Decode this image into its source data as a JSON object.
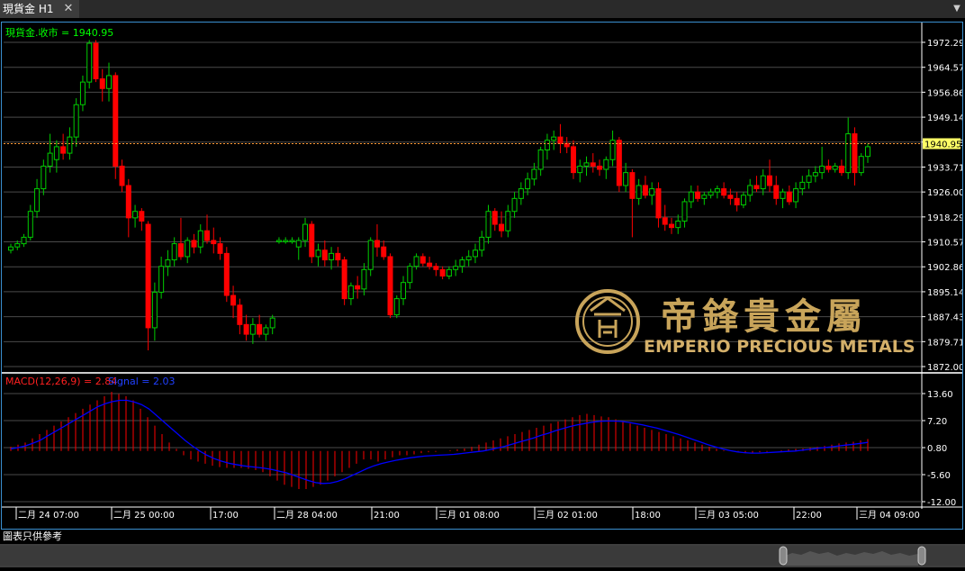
{
  "tab": {
    "title": "現貨金 H1",
    "close_glyph": "✕",
    "menu_glyph": "▼"
  },
  "chart_data": {
    "type": "candlestick",
    "symbol_label": "現貨金.收市 = 1940.95",
    "last_price": 1940.95,
    "last_price_label": "1940.95",
    "ylim": [
      1872.0,
      1972.29
    ],
    "y_ticks": [
      "1972.29",
      "1964.57",
      "1956.86",
      "1949.14",
      "1941.43",
      "1933.71",
      "1926.00",
      "1918.29",
      "1910.57",
      "1902.86",
      "1895.14",
      "1887.43",
      "1879.71",
      "1872.00"
    ],
    "x_ticks": [
      "二月 24 07:00",
      "二月 25 00:00",
      "17:00",
      "二月 28 04:00",
      "21:00",
      "三月 01 08:00",
      "三月 02 01:00",
      "18:00",
      "三月 03 05:00",
      "22:00",
      "三月 04 09:00"
    ],
    "candles": [
      {
        "o": 1908,
        "h": 1910,
        "l": 1907,
        "c": 1909
      },
      {
        "o": 1909,
        "h": 1911,
        "l": 1908,
        "c": 1910
      },
      {
        "o": 1910,
        "h": 1913,
        "l": 1909,
        "c": 1912
      },
      {
        "o": 1912,
        "h": 1922,
        "l": 1911,
        "c": 1920
      },
      {
        "o": 1920,
        "h": 1930,
        "l": 1918,
        "c": 1927
      },
      {
        "o": 1927,
        "h": 1936,
        "l": 1925,
        "c": 1934
      },
      {
        "o": 1934,
        "h": 1944,
        "l": 1932,
        "c": 1938
      },
      {
        "o": 1936,
        "h": 1942,
        "l": 1932,
        "c": 1940
      },
      {
        "o": 1940,
        "h": 1944,
        "l": 1936,
        "c": 1938
      },
      {
        "o": 1938,
        "h": 1946,
        "l": 1936,
        "c": 1943
      },
      {
        "o": 1943,
        "h": 1955,
        "l": 1940,
        "c": 1953
      },
      {
        "o": 1953,
        "h": 1962,
        "l": 1951,
        "c": 1960
      },
      {
        "o": 1960,
        "h": 1973,
        "l": 1958,
        "c": 1972
      },
      {
        "o": 1972,
        "h": 1973,
        "l": 1960,
        "c": 1961
      },
      {
        "o": 1961,
        "h": 1964,
        "l": 1954,
        "c": 1958
      },
      {
        "o": 1958,
        "h": 1966,
        "l": 1954,
        "c": 1962
      },
      {
        "o": 1962,
        "h": 1963,
        "l": 1930,
        "c": 1934
      },
      {
        "o": 1934,
        "h": 1936,
        "l": 1926,
        "c": 1928
      },
      {
        "o": 1928,
        "h": 1930,
        "l": 1912,
        "c": 1918
      },
      {
        "o": 1918,
        "h": 1922,
        "l": 1915,
        "c": 1920
      },
      {
        "o": 1920,
        "h": 1921,
        "l": 1914,
        "c": 1917
      },
      {
        "o": 1916,
        "h": 1917,
        "l": 1877,
        "c": 1884
      },
      {
        "o": 1884,
        "h": 1898,
        "l": 1880,
        "c": 1895
      },
      {
        "o": 1895,
        "h": 1906,
        "l": 1893,
        "c": 1903
      },
      {
        "o": 1903,
        "h": 1908,
        "l": 1900,
        "c": 1905
      },
      {
        "o": 1905,
        "h": 1912,
        "l": 1903,
        "c": 1910
      },
      {
        "o": 1910,
        "h": 1918,
        "l": 1905,
        "c": 1906
      },
      {
        "o": 1906,
        "h": 1912,
        "l": 1904,
        "c": 1911
      },
      {
        "o": 1911,
        "h": 1913,
        "l": 1907,
        "c": 1909
      },
      {
        "o": 1909,
        "h": 1916,
        "l": 1907,
        "c": 1914
      },
      {
        "o": 1914,
        "h": 1919,
        "l": 1910,
        "c": 1911
      },
      {
        "o": 1911,
        "h": 1915,
        "l": 1907,
        "c": 1910
      },
      {
        "o": 1910,
        "h": 1912,
        "l": 1905,
        "c": 1907
      },
      {
        "o": 1907,
        "h": 1909,
        "l": 1892,
        "c": 1894
      },
      {
        "o": 1894,
        "h": 1897,
        "l": 1887,
        "c": 1891
      },
      {
        "o": 1891,
        "h": 1893,
        "l": 1882,
        "c": 1885
      },
      {
        "o": 1885,
        "h": 1888,
        "l": 1880,
        "c": 1882
      },
      {
        "o": 1882,
        "h": 1887,
        "l": 1879,
        "c": 1885
      },
      {
        "o": 1885,
        "h": 1888,
        "l": 1881,
        "c": 1882
      },
      {
        "o": 1882,
        "h": 1885,
        "l": 1880,
        "c": 1884
      },
      {
        "o": 1884,
        "h": 1888,
        "l": 1882,
        "c": 1887
      },
      {
        "o": 1911,
        "h": 1912,
        "l": 1910,
        "c": 1911
      },
      {
        "o": 1911,
        "h": 1912,
        "l": 1910,
        "c": 1911
      },
      {
        "o": 1911,
        "h": 1912,
        "l": 1910,
        "c": 1911
      },
      {
        "o": 1909,
        "h": 1912,
        "l": 1905,
        "c": 1911
      },
      {
        "o": 1911,
        "h": 1918,
        "l": 1909,
        "c": 1916
      },
      {
        "o": 1916,
        "h": 1917,
        "l": 1904,
        "c": 1906
      },
      {
        "o": 1906,
        "h": 1910,
        "l": 1903,
        "c": 1908
      },
      {
        "o": 1908,
        "h": 1911,
        "l": 1903,
        "c": 1905
      },
      {
        "o": 1905,
        "h": 1909,
        "l": 1902,
        "c": 1907
      },
      {
        "o": 1907,
        "h": 1909,
        "l": 1903,
        "c": 1905
      },
      {
        "o": 1905,
        "h": 1906,
        "l": 1891,
        "c": 1893
      },
      {
        "o": 1893,
        "h": 1898,
        "l": 1891,
        "c": 1897
      },
      {
        "o": 1897,
        "h": 1900,
        "l": 1893,
        "c": 1896
      },
      {
        "o": 1896,
        "h": 1904,
        "l": 1894,
        "c": 1902
      },
      {
        "o": 1902,
        "h": 1912,
        "l": 1900,
        "c": 1911
      },
      {
        "o": 1911,
        "h": 1916,
        "l": 1906,
        "c": 1909
      },
      {
        "o": 1909,
        "h": 1911,
        "l": 1905,
        "c": 1906
      },
      {
        "o": 1906,
        "h": 1907,
        "l": 1887,
        "c": 1888
      },
      {
        "o": 1888,
        "h": 1894,
        "l": 1887,
        "c": 1893
      },
      {
        "o": 1893,
        "h": 1900,
        "l": 1891,
        "c": 1898
      },
      {
        "o": 1898,
        "h": 1904,
        "l": 1896,
        "c": 1903
      },
      {
        "o": 1903,
        "h": 1907,
        "l": 1902,
        "c": 1906
      },
      {
        "o": 1906,
        "h": 1907,
        "l": 1903,
        "c": 1904
      },
      {
        "o": 1904,
        "h": 1906,
        "l": 1902,
        "c": 1903
      },
      {
        "o": 1903,
        "h": 1904,
        "l": 1900,
        "c": 1902
      },
      {
        "o": 1902,
        "h": 1903,
        "l": 1899,
        "c": 1900
      },
      {
        "o": 1900,
        "h": 1903,
        "l": 1899,
        "c": 1902
      },
      {
        "o": 1902,
        "h": 1905,
        "l": 1900,
        "c": 1903
      },
      {
        "o": 1903,
        "h": 1906,
        "l": 1901,
        "c": 1905
      },
      {
        "o": 1905,
        "h": 1908,
        "l": 1903,
        "c": 1906
      },
      {
        "o": 1906,
        "h": 1910,
        "l": 1904,
        "c": 1908
      },
      {
        "o": 1908,
        "h": 1914,
        "l": 1906,
        "c": 1912
      },
      {
        "o": 1912,
        "h": 1922,
        "l": 1910,
        "c": 1920
      },
      {
        "o": 1920,
        "h": 1921,
        "l": 1914,
        "c": 1916
      },
      {
        "o": 1916,
        "h": 1920,
        "l": 1912,
        "c": 1914
      },
      {
        "o": 1914,
        "h": 1922,
        "l": 1912,
        "c": 1920
      },
      {
        "o": 1920,
        "h": 1926,
        "l": 1918,
        "c": 1924
      },
      {
        "o": 1924,
        "h": 1929,
        "l": 1922,
        "c": 1927
      },
      {
        "o": 1927,
        "h": 1932,
        "l": 1925,
        "c": 1930
      },
      {
        "o": 1930,
        "h": 1935,
        "l": 1928,
        "c": 1933
      },
      {
        "o": 1933,
        "h": 1940,
        "l": 1931,
        "c": 1939
      },
      {
        "o": 1939,
        "h": 1944,
        "l": 1936,
        "c": 1942
      },
      {
        "o": 1942,
        "h": 1945,
        "l": 1939,
        "c": 1943
      },
      {
        "o": 1943,
        "h": 1947,
        "l": 1938,
        "c": 1941
      },
      {
        "o": 1941,
        "h": 1943,
        "l": 1938,
        "c": 1940
      },
      {
        "o": 1940,
        "h": 1942,
        "l": 1930,
        "c": 1932
      },
      {
        "o": 1932,
        "h": 1936,
        "l": 1929,
        "c": 1934
      },
      {
        "o": 1934,
        "h": 1937,
        "l": 1931,
        "c": 1935
      },
      {
        "o": 1935,
        "h": 1938,
        "l": 1932,
        "c": 1934
      },
      {
        "o": 1934,
        "h": 1936,
        "l": 1931,
        "c": 1933
      },
      {
        "o": 1933,
        "h": 1937,
        "l": 1930,
        "c": 1936
      },
      {
        "o": 1936,
        "h": 1945,
        "l": 1934,
        "c": 1942
      },
      {
        "o": 1942,
        "h": 1943,
        "l": 1926,
        "c": 1928
      },
      {
        "o": 1928,
        "h": 1935,
        "l": 1926,
        "c": 1932
      },
      {
        "o": 1932,
        "h": 1933,
        "l": 1912,
        "c": 1924
      },
      {
        "o": 1924,
        "h": 1930,
        "l": 1922,
        "c": 1928
      },
      {
        "o": 1928,
        "h": 1931,
        "l": 1924,
        "c": 1925
      },
      {
        "o": 1925,
        "h": 1929,
        "l": 1922,
        "c": 1927
      },
      {
        "o": 1927,
        "h": 1929,
        "l": 1915,
        "c": 1918
      },
      {
        "o": 1918,
        "h": 1922,
        "l": 1914,
        "c": 1916
      },
      {
        "o": 1916,
        "h": 1918,
        "l": 1913,
        "c": 1915
      },
      {
        "o": 1915,
        "h": 1919,
        "l": 1913,
        "c": 1917
      },
      {
        "o": 1917,
        "h": 1924,
        "l": 1915,
        "c": 1923
      },
      {
        "o": 1923,
        "h": 1928,
        "l": 1921,
        "c": 1926
      },
      {
        "o": 1926,
        "h": 1928,
        "l": 1923,
        "c": 1924
      },
      {
        "o": 1924,
        "h": 1926,
        "l": 1922,
        "c": 1925
      },
      {
        "o": 1925,
        "h": 1927,
        "l": 1924,
        "c": 1926
      },
      {
        "o": 1926,
        "h": 1928,
        "l": 1924,
        "c": 1927
      },
      {
        "o": 1927,
        "h": 1929,
        "l": 1924,
        "c": 1925
      },
      {
        "o": 1925,
        "h": 1927,
        "l": 1922,
        "c": 1924
      },
      {
        "o": 1924,
        "h": 1926,
        "l": 1920,
        "c": 1922
      },
      {
        "o": 1922,
        "h": 1926,
        "l": 1921,
        "c": 1925
      },
      {
        "o": 1925,
        "h": 1930,
        "l": 1923,
        "c": 1928
      },
      {
        "o": 1928,
        "h": 1931,
        "l": 1926,
        "c": 1927
      },
      {
        "o": 1927,
        "h": 1933,
        "l": 1925,
        "c": 1931
      },
      {
        "o": 1931,
        "h": 1936,
        "l": 1926,
        "c": 1928
      },
      {
        "o": 1928,
        "h": 1931,
        "l": 1922,
        "c": 1924
      },
      {
        "o": 1924,
        "h": 1927,
        "l": 1921,
        "c": 1926
      },
      {
        "o": 1926,
        "h": 1928,
        "l": 1922,
        "c": 1923
      },
      {
        "o": 1923,
        "h": 1929,
        "l": 1921,
        "c": 1927
      },
      {
        "o": 1927,
        "h": 1931,
        "l": 1925,
        "c": 1929
      },
      {
        "o": 1929,
        "h": 1933,
        "l": 1927,
        "c": 1931
      },
      {
        "o": 1931,
        "h": 1934,
        "l": 1929,
        "c": 1932
      },
      {
        "o": 1932,
        "h": 1940,
        "l": 1930,
        "c": 1934
      },
      {
        "o": 1934,
        "h": 1936,
        "l": 1932,
        "c": 1933
      },
      {
        "o": 1933,
        "h": 1935,
        "l": 1932,
        "c": 1934
      },
      {
        "o": 1934,
        "h": 1936,
        "l": 1931,
        "c": 1932
      },
      {
        "o": 1932,
        "h": 1949,
        "l": 1930,
        "c": 1944
      },
      {
        "o": 1944,
        "h": 1946,
        "l": 1928,
        "c": 1932
      },
      {
        "o": 1932,
        "h": 1938,
        "l": 1931,
        "c": 1937
      },
      {
        "o": 1937,
        "h": 1941,
        "l": 1935,
        "c": 1940
      }
    ],
    "macd": {
      "label": "MACD(12,26,9) = 2.84",
      "signal_label": "Signal = 2.03",
      "value": 2.84,
      "signal": 2.03,
      "y_ticks": [
        "13.60",
        "7.20",
        "0.80",
        "-5.60",
        "-12.00"
      ],
      "ylim": [
        -12.0,
        13.6
      ],
      "histogram": [
        1,
        1.5,
        2,
        3,
        4,
        5,
        6,
        7,
        8,
        9,
        10,
        11,
        12,
        13,
        14,
        13.5,
        13,
        12,
        10,
        8,
        6,
        4,
        2,
        0.5,
        -1,
        -2,
        -2.5,
        -3,
        -3.5,
        -3.8,
        -4,
        -4,
        -4,
        -4.2,
        -4.5,
        -5,
        -6,
        -7,
        -8,
        -8.5,
        -9,
        -9,
        -8.5,
        -8,
        -7,
        -6,
        -5,
        -4,
        -3,
        -2,
        -2,
        -2.5,
        -2,
        -1.5,
        -1,
        -1,
        -0.8,
        -0.5,
        -0.3,
        -0.2,
        0,
        0.2,
        0.4,
        0.6,
        1,
        1.5,
        2,
        2.5,
        3,
        3.5,
        4,
        4.5,
        5,
        5.5,
        6,
        6.5,
        7,
        7.5,
        8,
        8.5,
        8.8,
        8.5,
        8.2,
        8,
        7.5,
        7,
        6.5,
        6,
        5.5,
        5,
        4.5,
        4,
        3.5,
        3,
        2.5,
        2,
        1.5,
        1,
        0.5,
        0.2,
        0,
        -0.3,
        -0.5,
        -0.5,
        -0.3,
        -0.2,
        0,
        0.2,
        0.4,
        0.5,
        0.6,
        0.8,
        1,
        1.2,
        1.5,
        1.8,
        2,
        2.2,
        2.5,
        2.84
      ],
      "signal_line": [
        0.5,
        0.8,
        1.2,
        1.8,
        2.5,
        3.5,
        4.5,
        5.5,
        6.5,
        7.5,
        8.5,
        9.5,
        10.5,
        11.2,
        11.7,
        12,
        12,
        11.6,
        11,
        10,
        8.5,
        7,
        5.5,
        4,
        2.5,
        1.2,
        0,
        -1,
        -1.8,
        -2.4,
        -2.9,
        -3.2,
        -3.5,
        -3.7,
        -3.9,
        -4.1,
        -4.4,
        -4.8,
        -5.2,
        -5.8,
        -6.4,
        -7,
        -7.5,
        -7.7,
        -7.6,
        -7.2,
        -6.6,
        -5.8,
        -5,
        -4.2,
        -3.5,
        -3,
        -2.6,
        -2.2,
        -1.9,
        -1.6,
        -1.4,
        -1.2,
        -1.1,
        -1,
        -0.9,
        -0.8,
        -0.6,
        -0.4,
        -0.2,
        0,
        0.3,
        0.7,
        1.1,
        1.6,
        2.1,
        2.6,
        3.1,
        3.7,
        4.2,
        4.8,
        5.3,
        5.8,
        6.2,
        6.5,
        6.8,
        7,
        7.1,
        7.1,
        7,
        6.8,
        6.5,
        6.2,
        5.8,
        5.4,
        4.9,
        4.4,
        3.9,
        3.3,
        2.7,
        2.1,
        1.5,
        1,
        0.5,
        0.1,
        -0.2,
        -0.4,
        -0.5,
        -0.5,
        -0.4,
        -0.3,
        -0.2,
        -0.1,
        0,
        0.2,
        0.4,
        0.6,
        0.8,
        1,
        1.2,
        1.4,
        1.6,
        1.8,
        2.03
      ]
    },
    "colors": {
      "up": "#00cc00",
      "down": "#ff0000",
      "macd_bar": "#ff0000",
      "signal": "#0000ff",
      "price_line": "#ff9933",
      "axis_text": "#ffffff",
      "label_green": "#00ff00"
    }
  },
  "logo": {
    "chinese": "帝鋒貴金屬",
    "english": "EMPERIO PRECIOUS METALS"
  },
  "footer": {
    "note": "圖表只供參考"
  }
}
